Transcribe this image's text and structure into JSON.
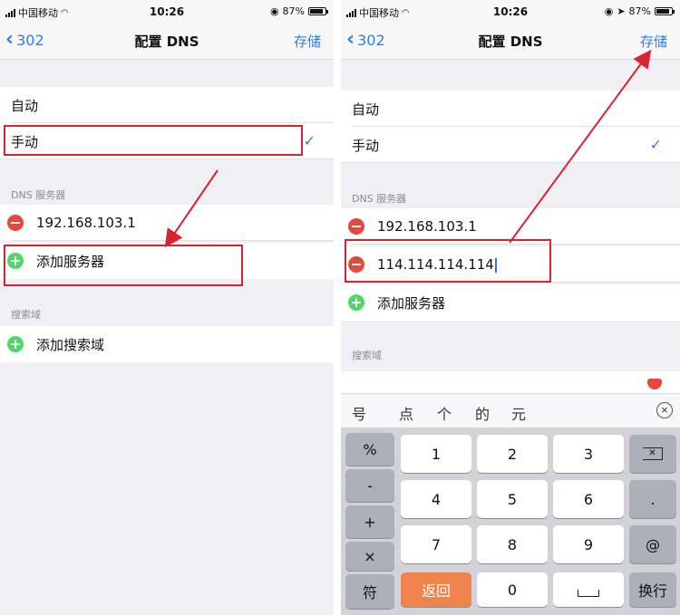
{
  "left": {
    "status": {
      "carrier": "中国移动",
      "time": "10:26",
      "battery": "87%"
    },
    "nav": {
      "back": "302",
      "title": "配置 DNS",
      "save": "存储"
    },
    "mode_options": [
      "自动",
      "手动"
    ],
    "dns_header": "DNS 服务器",
    "dns_servers": [
      "192.168.103.1"
    ],
    "add_server": "添加服务器",
    "search_header": "搜索域",
    "add_search_domain": "添加搜索域"
  },
  "right": {
    "status": {
      "carrier": "中国移动",
      "time": "10:26",
      "battery": "87%"
    },
    "nav": {
      "back": "302",
      "title": "配置 DNS",
      "save": "存储"
    },
    "mode_options": [
      "自动",
      "手动"
    ],
    "dns_header": "DNS 服务器",
    "dns_servers": [
      "192.168.103.1",
      "114.114.114.114"
    ],
    "add_server": "添加服务器",
    "search_header": "搜索域",
    "suggestions": [
      "号",
      "点",
      "个",
      "的",
      "元"
    ],
    "keyboard": {
      "symbols": [
        "%",
        "-",
        "+",
        "×",
        "符"
      ],
      "digits": [
        "1",
        "2",
        "3",
        "4",
        "5",
        "6",
        "7",
        "8",
        "9",
        "0"
      ],
      "dot": ".",
      "at": "@",
      "back": "返回",
      "newline": "换行"
    }
  },
  "icons": {
    "check": "checkmark-icon",
    "minus": "minus-circle-icon",
    "plus": "plus-circle-icon",
    "delete": "backspace-icon",
    "clear": "clear-icon"
  },
  "colors": {
    "ios_blue": "#2d7cf6",
    "annotation_red": "#d9232e",
    "minus_red": "#e5483d",
    "plus_green": "#4cd964",
    "key_orange": "#f0844c"
  }
}
